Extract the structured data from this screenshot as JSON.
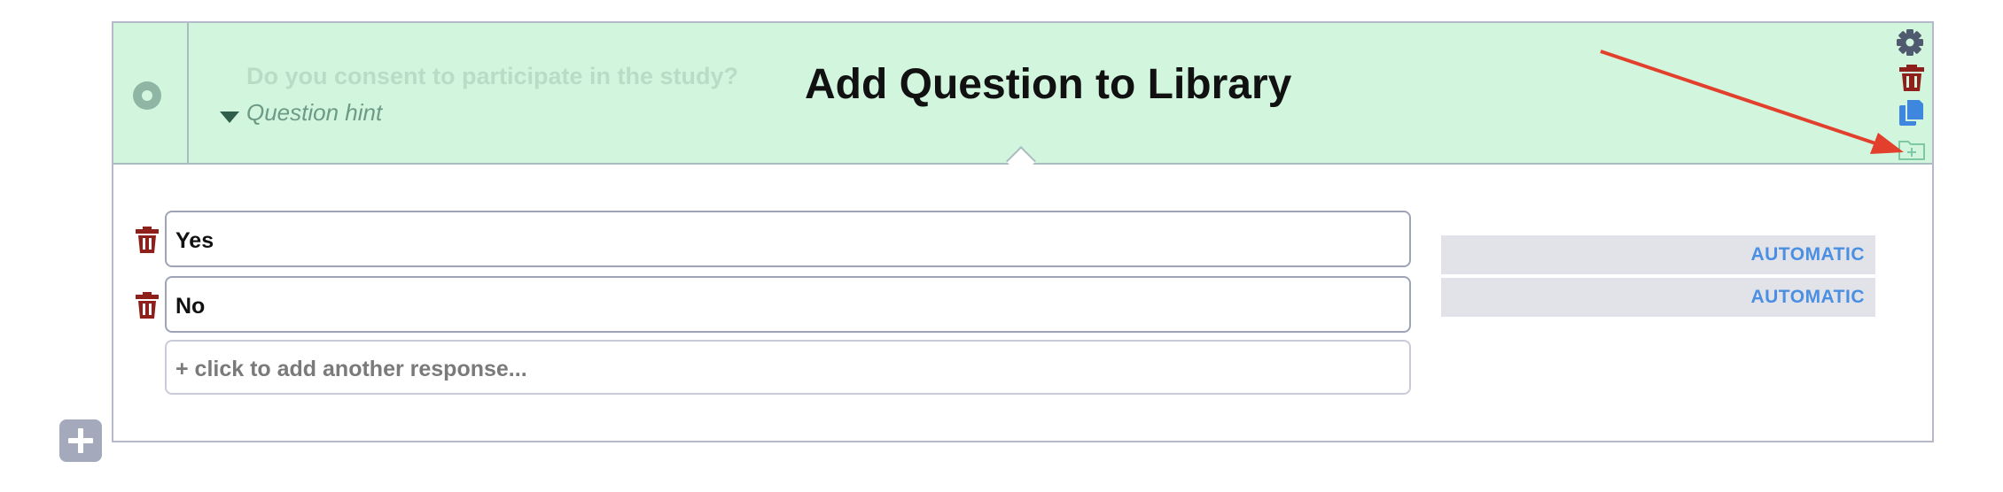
{
  "question": {
    "text": "Do you consent to participate in the study?",
    "hint_placeholder": "Question hint"
  },
  "overlay": {
    "title": "Add Question to Library"
  },
  "toolbar": {
    "icons": [
      "gear-icon",
      "trash-icon",
      "copy-icon",
      "add-to-library-folder-icon"
    ]
  },
  "responses": [
    {
      "label": "Yes",
      "value_mode": "AUTOMATIC"
    },
    {
      "label": "No",
      "value_mode": "AUTOMATIC"
    }
  ],
  "add_response": {
    "placeholder": "+ click to add another response..."
  },
  "colors": {
    "header_bg": "#d1f5dd",
    "trash": "#8e1f1a",
    "copy": "#3f86de",
    "gear": "#505a6f",
    "automatic_text": "#4b8fe3",
    "annotation_arrow": "#e2402c"
  }
}
